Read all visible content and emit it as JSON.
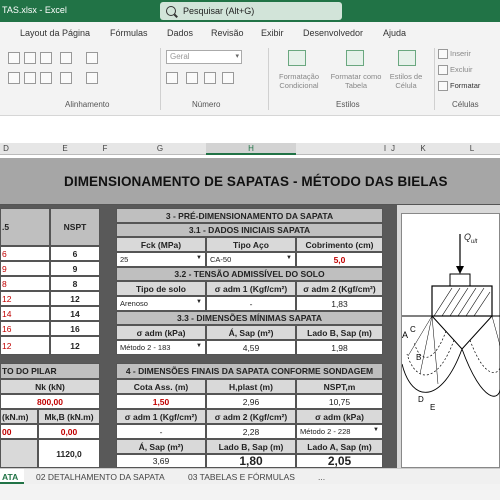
{
  "window": {
    "filename": "TAS.xlsx  -  Excel",
    "search_placeholder": "Pesquisar (Alt+G)"
  },
  "menu": [
    "Layout da Página",
    "Fórmulas",
    "Dados",
    "Revisão",
    "Exibir",
    "Desenvolvedor",
    "Ajuda"
  ],
  "ribbon": {
    "groups": [
      "Alinhamento",
      "Número",
      "Estilos",
      "Células"
    ],
    "number_format": "Geral",
    "styles": [
      "Formatação Condicional",
      "Formatar como Tabela",
      "Estilos de Célula"
    ],
    "cells": [
      "Inserir",
      "Excluir",
      "Formatar"
    ]
  },
  "columns": [
    "D",
    "E",
    "F",
    "G",
    "H",
    "I",
    "J",
    "K",
    "L"
  ],
  "sheet": {
    "title": "DIMENSIONAMENTO DE SAPATAS - MÉTODO DAS BIELAS",
    "left": {
      "hdr_frag": ".5",
      "nspt_label": "NSPT",
      "rows": [
        {
          "a": "6",
          "b": "6"
        },
        {
          "a": "9",
          "b": "9"
        },
        {
          "a": "8",
          "b": "8"
        },
        {
          "a": "12",
          "b": "12"
        },
        {
          "a": "14",
          "b": "14"
        },
        {
          "a": "16",
          "b": "16"
        },
        {
          "a": "12",
          "b": "12"
        }
      ],
      "pilar_title": "TO DO PILAR",
      "nk_label": "Nk (kN)",
      "nk_value": "800,00",
      "mk_a_label": "(kN.m)",
      "mk_b_label": "Mk,B (kN.m)",
      "mk_a_value": "00",
      "mk_b_value": "0,00",
      "extra_value": "1120,0"
    },
    "s3": {
      "title": "3 - PRÉ-DIMENSIONAMENTO DA SAPATA",
      "s31_title": "3.1 - DADOS INICIAIS SAPATA",
      "fck_label": "Fck (MPa)",
      "aco_label": "Tipo Aço",
      "cob_label": "Cobrimento (cm)",
      "fck_value": "25",
      "aco_value": "CA-50",
      "cob_value": "5,0",
      "s32_title": "3.2 - TENSÃO ADMISSÍVEL DO SOLO",
      "solo_label": "Tipo de solo",
      "adm1_label": "σ adm 1 (Kgf/cm²)",
      "adm2_label": "σ adm 2 (Kgf/cm²)",
      "solo_value": "Arenoso",
      "adm1_value": "-",
      "adm2_value": "1,83",
      "s33_title": "3.3 - DIMENSÕES MÍNIMAS SAPATA",
      "sadm_label": "σ adm (kPa)",
      "area_label": "Á, Sap (m²)",
      "ladob_label": "Lado B, Sap (m)",
      "metodo_value": "Método 2 -  183",
      "area_value": "4,59",
      "ladob_value": "1,98"
    },
    "s4": {
      "title": "4 - DIMENSÕES FINAIS DA SAPATA CONFORME SONDAGEM",
      "cota_label": "Cota Ass. (m)",
      "hplast_label": "H,plast (m)",
      "nspt_label": "NSPT,m",
      "cota_value": "1,50",
      "hplast_value": "2,96",
      "nspt_value": "10,75",
      "adm1_label": "σ adm 1 (Kgf/cm²)",
      "adm2_label": "σ adm 2 (Kgf/cm²)",
      "sadm_label": "σ adm (kPa)",
      "adm1_value": "-",
      "adm2_value": "2,28",
      "metodo_value": "Método 2 -  228",
      "area_label": "Á, Sap (m²)",
      "ladob_label": "Lado B, Sap (m)",
      "ladoa_label": "Lado A, Sap (m)",
      "area_value": "3,69",
      "ladob_value": "1,80",
      "ladoa_value": "2,05"
    },
    "figure": {
      "label": "Q",
      "sub": "ult"
    }
  },
  "tabs": [
    "ATA",
    "02 DETALHAMENTO DA SAPATA",
    "03 TABELAS E FÓRMULAS",
    "..."
  ]
}
